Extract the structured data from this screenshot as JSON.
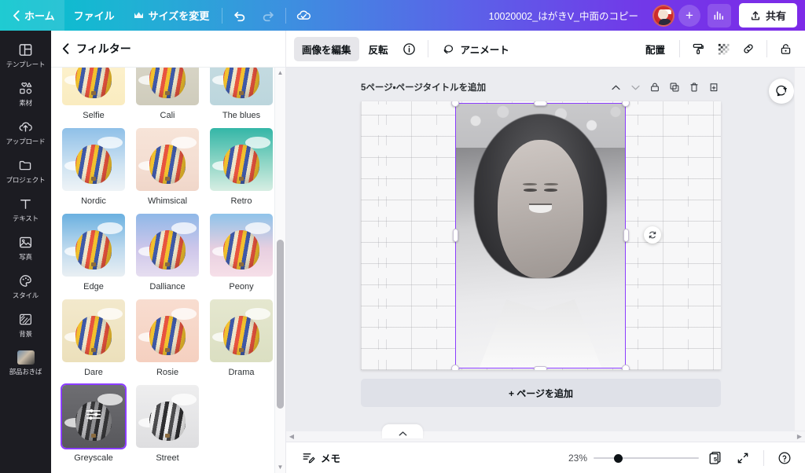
{
  "topbar": {
    "home_label": "ホーム",
    "file_label": "ファイル",
    "resize_label": "サイズを変更",
    "crown_icon": "crown-icon",
    "undo_icon": "undo-icon",
    "redo_icon": "redo-icon",
    "saved_icon": "cloud-check-icon",
    "doc_title": "10020002_はがきV_中面のコピー",
    "avatar_name": "avatar",
    "add_member_label": "+",
    "analytics_icon": "analytics-icon",
    "share_label": "共有",
    "share_icon": "upload-icon",
    "accent_start": "#00c4cc",
    "accent_end": "#7d2ae8"
  },
  "rail": {
    "items": [
      {
        "label": "テンプレート",
        "icon": "template-icon"
      },
      {
        "label": "素材",
        "icon": "elements-icon"
      },
      {
        "label": "アップロード",
        "icon": "upload-cloud-icon"
      },
      {
        "label": "プロジェクト",
        "icon": "folder-icon"
      },
      {
        "label": "テキスト",
        "icon": "text-icon"
      },
      {
        "label": "写真",
        "icon": "photo-icon"
      },
      {
        "label": "スタイル",
        "icon": "palette-icon"
      },
      {
        "label": "背景",
        "icon": "background-icon"
      },
      {
        "label": "部品おきば",
        "icon": "custom-folder-thumb"
      }
    ]
  },
  "panel": {
    "back_icon": "chevron-left-icon",
    "title": "フィルター",
    "filters": [
      {
        "name": "Selfie",
        "class": "f-selfie",
        "selected": false
      },
      {
        "name": "Cali",
        "class": "f-cali",
        "selected": false
      },
      {
        "name": "The blues",
        "class": "f-blues",
        "selected": false
      },
      {
        "name": "Nordic",
        "class": "f-nordic",
        "selected": false
      },
      {
        "name": "Whimsical",
        "class": "f-whimsical",
        "selected": false
      },
      {
        "name": "Retro",
        "class": "f-retro",
        "selected": false
      },
      {
        "name": "Edge",
        "class": "f-edge",
        "selected": false
      },
      {
        "name": "Dalliance",
        "class": "f-dalliance",
        "selected": false
      },
      {
        "name": "Peony",
        "class": "f-peony",
        "selected": false
      },
      {
        "name": "Dare",
        "class": "f-dare",
        "selected": false
      },
      {
        "name": "Rosie",
        "class": "f-rosie",
        "selected": false
      },
      {
        "name": "Drama",
        "class": "f-drama",
        "selected": false
      },
      {
        "name": "Greyscale",
        "class": "f-greyscale",
        "selected": true
      },
      {
        "name": "Street",
        "class": "f-street",
        "selected": false
      }
    ],
    "selected_filter": "Greyscale",
    "selection_color": "#8b3dff"
  },
  "edit_toolbar": {
    "edit_image_label": "画像を編集",
    "flip_label": "反転",
    "info_icon": "info-icon",
    "animate_label": "アニメート",
    "animate_icon": "animate-icon",
    "position_label": "配置",
    "paint_icon": "paint-roller-icon",
    "transparency_icon": "transparency-icon",
    "link_icon": "link-icon",
    "lock_icon": "lock-icon"
  },
  "canvas": {
    "page_label": "5ページ・ページタイトルを追加",
    "move_up_icon": "chevron-up-icon",
    "move_down_icon": "chevron-down-icon",
    "lock_page_icon": "lock-page-icon",
    "duplicate_page_icon": "duplicate-page-icon",
    "delete_page_icon": "trash-icon",
    "add_page_after_icon": "add-page-icon",
    "comment_icon": "add-comment-icon",
    "rotate_icon": "rotate-icon",
    "add_page_label": "+ ページを追加",
    "selection_color": "#8b3dff"
  },
  "bottombar": {
    "notes_label": "メモ",
    "notes_icon": "notes-icon",
    "zoom_value": "23%",
    "page_count": "5",
    "pages_icon": "pages-icon",
    "fullscreen_icon": "fullscreen-icon",
    "help_icon": "help-icon"
  }
}
